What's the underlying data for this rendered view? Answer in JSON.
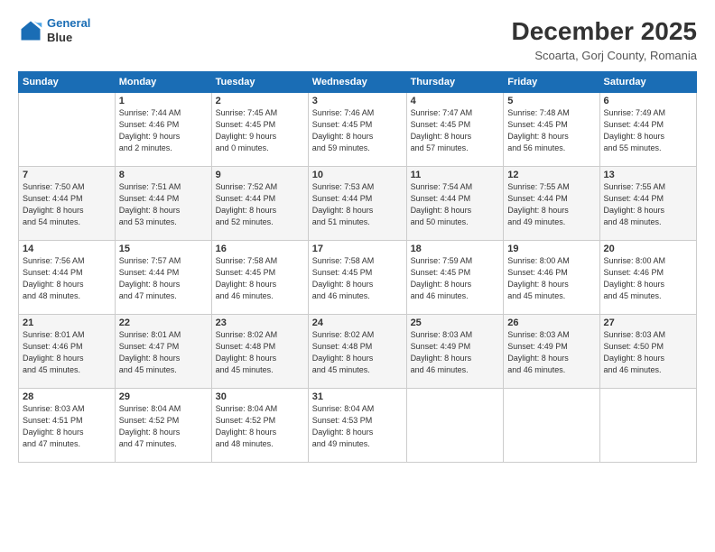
{
  "logo": {
    "line1": "General",
    "line2": "Blue"
  },
  "title": "December 2025",
  "subtitle": "Scoarta, Gorj County, Romania",
  "days_header": [
    "Sunday",
    "Monday",
    "Tuesday",
    "Wednesday",
    "Thursday",
    "Friday",
    "Saturday"
  ],
  "weeks": [
    [
      {
        "day": "",
        "sunrise": "",
        "sunset": "",
        "daylight": ""
      },
      {
        "day": "1",
        "sunrise": "Sunrise: 7:44 AM",
        "sunset": "Sunset: 4:46 PM",
        "daylight": "Daylight: 9 hours and 2 minutes."
      },
      {
        "day": "2",
        "sunrise": "Sunrise: 7:45 AM",
        "sunset": "Sunset: 4:45 PM",
        "daylight": "Daylight: 9 hours and 0 minutes."
      },
      {
        "day": "3",
        "sunrise": "Sunrise: 7:46 AM",
        "sunset": "Sunset: 4:45 PM",
        "daylight": "Daylight: 8 hours and 59 minutes."
      },
      {
        "day": "4",
        "sunrise": "Sunrise: 7:47 AM",
        "sunset": "Sunset: 4:45 PM",
        "daylight": "Daylight: 8 hours and 57 minutes."
      },
      {
        "day": "5",
        "sunrise": "Sunrise: 7:48 AM",
        "sunset": "Sunset: 4:45 PM",
        "daylight": "Daylight: 8 hours and 56 minutes."
      },
      {
        "day": "6",
        "sunrise": "Sunrise: 7:49 AM",
        "sunset": "Sunset: 4:44 PM",
        "daylight": "Daylight: 8 hours and 55 minutes."
      }
    ],
    [
      {
        "day": "7",
        "sunrise": "Sunrise: 7:50 AM",
        "sunset": "Sunset: 4:44 PM",
        "daylight": "Daylight: 8 hours and 54 minutes."
      },
      {
        "day": "8",
        "sunrise": "Sunrise: 7:51 AM",
        "sunset": "Sunset: 4:44 PM",
        "daylight": "Daylight: 8 hours and 53 minutes."
      },
      {
        "day": "9",
        "sunrise": "Sunrise: 7:52 AM",
        "sunset": "Sunset: 4:44 PM",
        "daylight": "Daylight: 8 hours and 52 minutes."
      },
      {
        "day": "10",
        "sunrise": "Sunrise: 7:53 AM",
        "sunset": "Sunset: 4:44 PM",
        "daylight": "Daylight: 8 hours and 51 minutes."
      },
      {
        "day": "11",
        "sunrise": "Sunrise: 7:54 AM",
        "sunset": "Sunset: 4:44 PM",
        "daylight": "Daylight: 8 hours and 50 minutes."
      },
      {
        "day": "12",
        "sunrise": "Sunrise: 7:55 AM",
        "sunset": "Sunset: 4:44 PM",
        "daylight": "Daylight: 8 hours and 49 minutes."
      },
      {
        "day": "13",
        "sunrise": "Sunrise: 7:55 AM",
        "sunset": "Sunset: 4:44 PM",
        "daylight": "Daylight: 8 hours and 48 minutes."
      }
    ],
    [
      {
        "day": "14",
        "sunrise": "Sunrise: 7:56 AM",
        "sunset": "Sunset: 4:44 PM",
        "daylight": "Daylight: 8 hours and 48 minutes."
      },
      {
        "day": "15",
        "sunrise": "Sunrise: 7:57 AM",
        "sunset": "Sunset: 4:44 PM",
        "daylight": "Daylight: 8 hours and 47 minutes."
      },
      {
        "day": "16",
        "sunrise": "Sunrise: 7:58 AM",
        "sunset": "Sunset: 4:45 PM",
        "daylight": "Daylight: 8 hours and 46 minutes."
      },
      {
        "day": "17",
        "sunrise": "Sunrise: 7:58 AM",
        "sunset": "Sunset: 4:45 PM",
        "daylight": "Daylight: 8 hours and 46 minutes."
      },
      {
        "day": "18",
        "sunrise": "Sunrise: 7:59 AM",
        "sunset": "Sunset: 4:45 PM",
        "daylight": "Daylight: 8 hours and 46 minutes."
      },
      {
        "day": "19",
        "sunrise": "Sunrise: 8:00 AM",
        "sunset": "Sunset: 4:46 PM",
        "daylight": "Daylight: 8 hours and 45 minutes."
      },
      {
        "day": "20",
        "sunrise": "Sunrise: 8:00 AM",
        "sunset": "Sunset: 4:46 PM",
        "daylight": "Daylight: 8 hours and 45 minutes."
      }
    ],
    [
      {
        "day": "21",
        "sunrise": "Sunrise: 8:01 AM",
        "sunset": "Sunset: 4:46 PM",
        "daylight": "Daylight: 8 hours and 45 minutes."
      },
      {
        "day": "22",
        "sunrise": "Sunrise: 8:01 AM",
        "sunset": "Sunset: 4:47 PM",
        "daylight": "Daylight: 8 hours and 45 minutes."
      },
      {
        "day": "23",
        "sunrise": "Sunrise: 8:02 AM",
        "sunset": "Sunset: 4:48 PM",
        "daylight": "Daylight: 8 hours and 45 minutes."
      },
      {
        "day": "24",
        "sunrise": "Sunrise: 8:02 AM",
        "sunset": "Sunset: 4:48 PM",
        "daylight": "Daylight: 8 hours and 45 minutes."
      },
      {
        "day": "25",
        "sunrise": "Sunrise: 8:03 AM",
        "sunset": "Sunset: 4:49 PM",
        "daylight": "Daylight: 8 hours and 46 minutes."
      },
      {
        "day": "26",
        "sunrise": "Sunrise: 8:03 AM",
        "sunset": "Sunset: 4:49 PM",
        "daylight": "Daylight: 8 hours and 46 minutes."
      },
      {
        "day": "27",
        "sunrise": "Sunrise: 8:03 AM",
        "sunset": "Sunset: 4:50 PM",
        "daylight": "Daylight: 8 hours and 46 minutes."
      }
    ],
    [
      {
        "day": "28",
        "sunrise": "Sunrise: 8:03 AM",
        "sunset": "Sunset: 4:51 PM",
        "daylight": "Daylight: 8 hours and 47 minutes."
      },
      {
        "day": "29",
        "sunrise": "Sunrise: 8:04 AM",
        "sunset": "Sunset: 4:52 PM",
        "daylight": "Daylight: 8 hours and 47 minutes."
      },
      {
        "day": "30",
        "sunrise": "Sunrise: 8:04 AM",
        "sunset": "Sunset: 4:52 PM",
        "daylight": "Daylight: 8 hours and 48 minutes."
      },
      {
        "day": "31",
        "sunrise": "Sunrise: 8:04 AM",
        "sunset": "Sunset: 4:53 PM",
        "daylight": "Daylight: 8 hours and 49 minutes."
      },
      {
        "day": "",
        "sunrise": "",
        "sunset": "",
        "daylight": ""
      },
      {
        "day": "",
        "sunrise": "",
        "sunset": "",
        "daylight": ""
      },
      {
        "day": "",
        "sunrise": "",
        "sunset": "",
        "daylight": ""
      }
    ]
  ]
}
